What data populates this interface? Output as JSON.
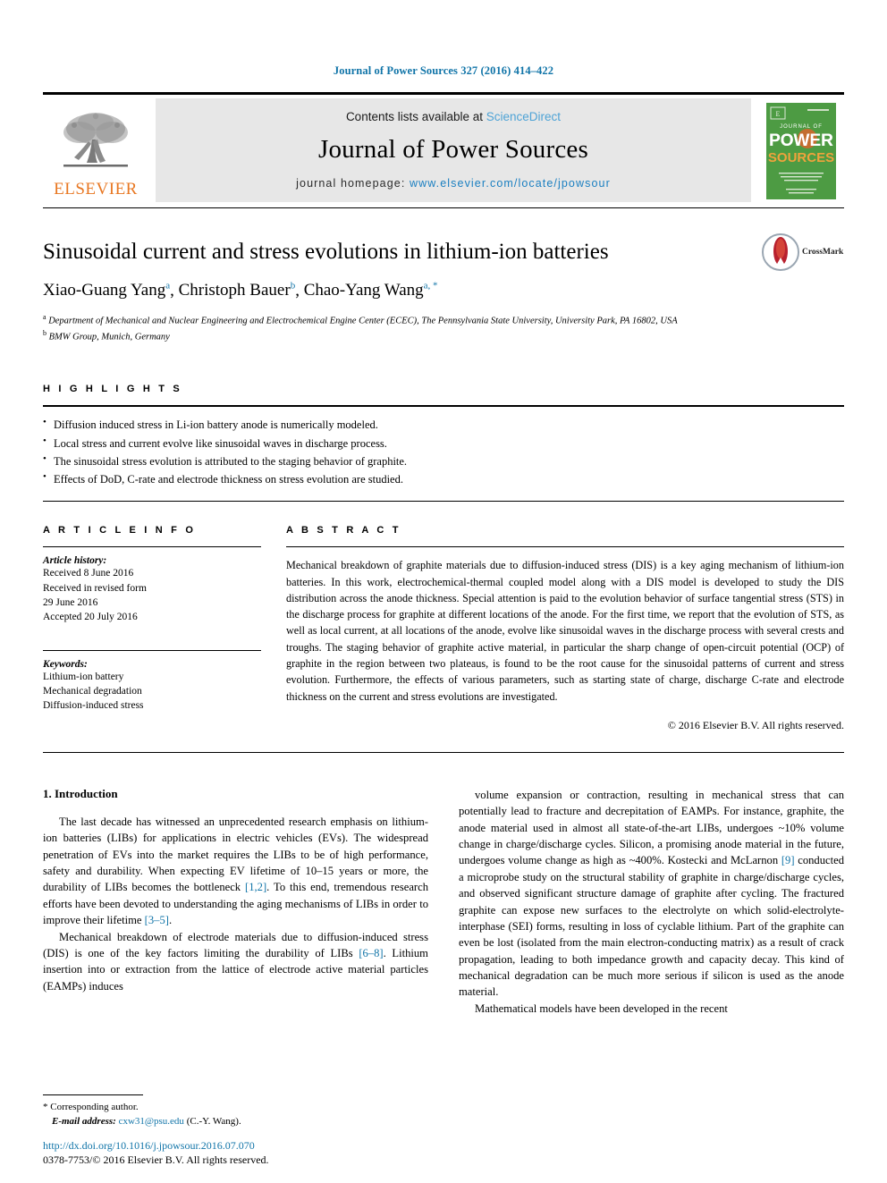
{
  "running_head": "Journal of Power Sources 327 (2016) 414–422",
  "masthead": {
    "publisher_name": "ELSEVIER",
    "contents_prefix": "Contents lists available at ",
    "contents_link": "ScienceDirect",
    "journal_title": "Journal of Power Sources",
    "homepage_prefix": "journal homepage: ",
    "homepage_url": "www.elsevier.com/locate/jpowsour",
    "cover_line1": "JOURNAL OF",
    "cover_line2": "POWER",
    "cover_line3": "SOURCES",
    "cover_color": "#4d9b43",
    "link_color": "#1a7fc1"
  },
  "article": {
    "title": "Sinusoidal current and stress evolutions in lithium-ion batteries",
    "authors_html": "Xiao-Guang Yang, Christoph Bauer, Chao-Yang Wang",
    "author_list": [
      {
        "name": "Xiao-Guang Yang",
        "marks": "a"
      },
      {
        "name": "Christoph Bauer",
        "marks": "b"
      },
      {
        "name": "Chao-Yang Wang",
        "marks": "a, *"
      }
    ],
    "affiliations": [
      {
        "mark": "a",
        "text": "Department of Mechanical and Nuclear Engineering and Electrochemical Engine Center (ECEC), The Pennsylvania State University, University Park, PA 16802, USA"
      },
      {
        "mark": "b",
        "text": "BMW Group, Munich, Germany"
      }
    ],
    "crossmark_label": "CrossMark"
  },
  "highlights": {
    "heading": "H I G H L I G H T S",
    "items": [
      "Diffusion induced stress in Li-ion battery anode is numerically modeled.",
      "Local stress and current evolve like sinusoidal waves in discharge process.",
      "The sinusoidal stress evolution is attributed to the staging behavior of graphite.",
      "Effects of DoD, C-rate and electrode thickness on stress evolution are studied."
    ]
  },
  "article_info": {
    "heading": "A R T I C L E   I N F O",
    "history_label": "Article history:",
    "history_lines": [
      "Received 8 June 2016",
      "Received in revised form",
      "29 June 2016",
      "Accepted 20 July 2016"
    ],
    "keywords_label": "Keywords:",
    "keywords": [
      "Lithium-ion battery",
      "Mechanical degradation",
      "Diffusion-induced stress"
    ]
  },
  "abstract": {
    "heading": "A B S T R A C T",
    "text": "Mechanical breakdown of graphite materials due to diffusion-induced stress (DIS) is a key aging mechanism of lithium-ion batteries. In this work, electrochemical-thermal coupled model along with a DIS model is developed to study the DIS distribution across the anode thickness. Special attention is paid to the evolution behavior of surface tangential stress (STS) in the discharge process for graphite at different locations of the anode. For the first time, we report that the evolution of STS, as well as local current, at all locations of the anode, evolve like sinusoidal waves in the discharge process with several crests and troughs. The staging behavior of graphite active material, in particular the sharp change of open-circuit potential (OCP) of graphite in the region between two plateaus, is found to be the root cause for the sinusoidal patterns of current and stress evolution. Furthermore, the effects of various parameters, such as starting state of charge, discharge C-rate and electrode thickness on the current and stress evolutions are investigated.",
    "copyright": "© 2016 Elsevier B.V. All rights reserved."
  },
  "body": {
    "section_number_title": "1. Introduction",
    "left_paragraphs": [
      {
        "segments": [
          {
            "t": "The last decade has witnessed an unprecedented research emphasis on lithium-ion batteries (LIBs) for applications in electric vehicles (EVs). The widespread penetration of EVs into the market requires the LIBs to be of high performance, safety and durability. When expecting EV lifetime of 10–15 years or more, the durability of LIBs becomes the bottleneck ",
            "c": false
          },
          {
            "t": "[1,2]",
            "c": true
          },
          {
            "t": ". To this end, tremendous research efforts have been devoted to understanding the aging mechanisms of LIBs in order to improve their lifetime ",
            "c": false
          },
          {
            "t": "[3–5]",
            "c": true
          },
          {
            "t": ".",
            "c": false
          }
        ]
      },
      {
        "segments": [
          {
            "t": "Mechanical breakdown of electrode materials due to diffusion-induced stress (DIS) is one of the key factors limiting the durability of LIBs ",
            "c": false
          },
          {
            "t": "[6–8]",
            "c": true
          },
          {
            "t": ". Lithium insertion into or extraction from the lattice of electrode active material particles (EAMPs) induces",
            "c": false
          }
        ]
      }
    ],
    "right_paragraphs": [
      {
        "segments": [
          {
            "t": "volume expansion or contraction, resulting in mechanical stress that can potentially lead to fracture and decrepitation of EAMPs. For instance, graphite, the anode material used in almost all state-of-the-art LIBs, undergoes ~10% volume change in charge/discharge cycles. Silicon, a promising anode material in the future, undergoes volume change as high as ~400%. Kostecki and McLarnon ",
            "c": false
          },
          {
            "t": "[9]",
            "c": true
          },
          {
            "t": " conducted a microprobe study on the structural stability of graphite in charge/discharge cycles, and observed significant structure damage of graphite after cycling. The fractured graphite can expose new surfaces to the electrolyte on which solid-electrolyte-interphase (SEI) forms, resulting in loss of cyclable lithium. Part of the graphite can even be lost (isolated from the main electron-conducting matrix) as a result of crack propagation, leading to both impedance growth and capacity decay. This kind of mechanical degradation can be much more serious if silicon is used as the anode material.",
            "c": false
          }
        ],
        "no_indent": false
      },
      {
        "segments": [
          {
            "t": "Mathematical models have been developed in the recent",
            "c": false
          }
        ]
      }
    ]
  },
  "footer": {
    "corresponding_marker": "*",
    "corresponding_text": "Corresponding author.",
    "email_label": "E-mail address:",
    "email": "cxw31@psu.edu",
    "email_suffix": " (C.-Y. Wang).",
    "doi": "http://dx.doi.org/10.1016/j.jpowsour.2016.07.070",
    "issn_line": "0378-7753/© 2016 Elsevier B.V. All rights reserved."
  }
}
